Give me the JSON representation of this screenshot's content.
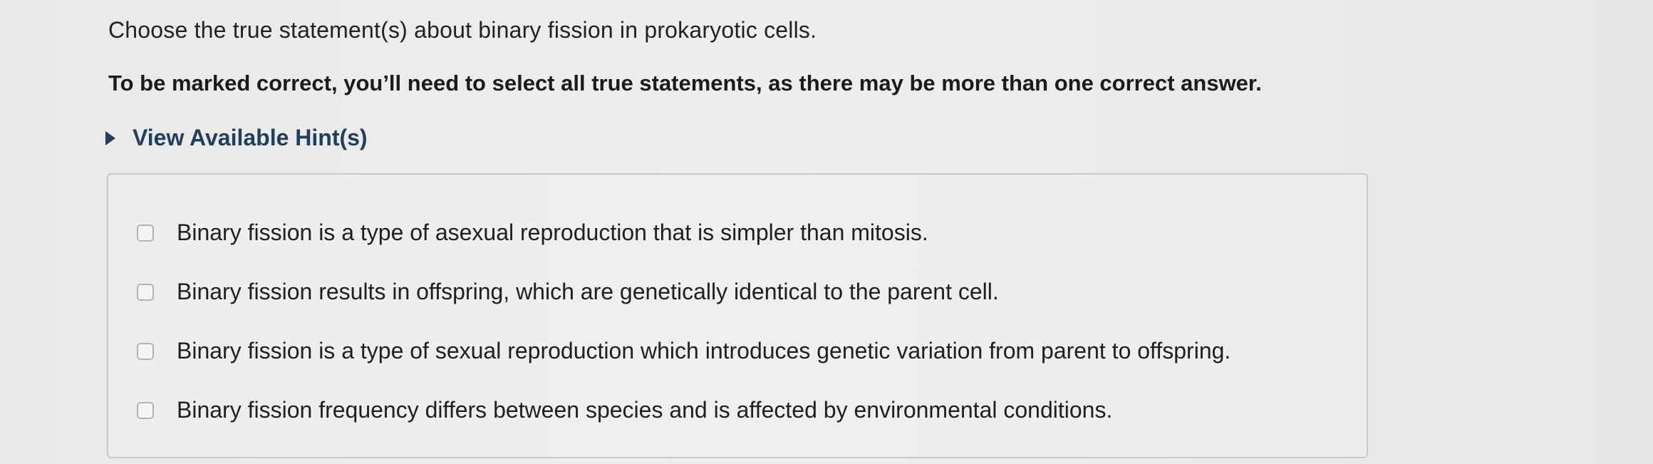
{
  "question": {
    "prompt": "Choose the true statement(s) about binary fission in prokaryotic cells.",
    "instructions": "To be marked correct, you’ll need to select all true statements, as there may be more than one correct answer."
  },
  "hint": {
    "label": "View Available Hint(s)",
    "icon": "triangle-right-icon",
    "color": "#1f3f5e"
  },
  "options": [
    {
      "label": "Binary fission is a type of asexual reproduction that is simpler than mitosis.",
      "checked": false
    },
    {
      "label": "Binary fission results in offspring, which are genetically identical to the parent cell.",
      "checked": false
    },
    {
      "label": "Binary fission is a type of sexual reproduction which introduces genetic variation from parent to offspring.",
      "checked": false
    },
    {
      "label": "Binary fission frequency differs between species and is affected by environmental conditions.",
      "checked": false
    }
  ]
}
